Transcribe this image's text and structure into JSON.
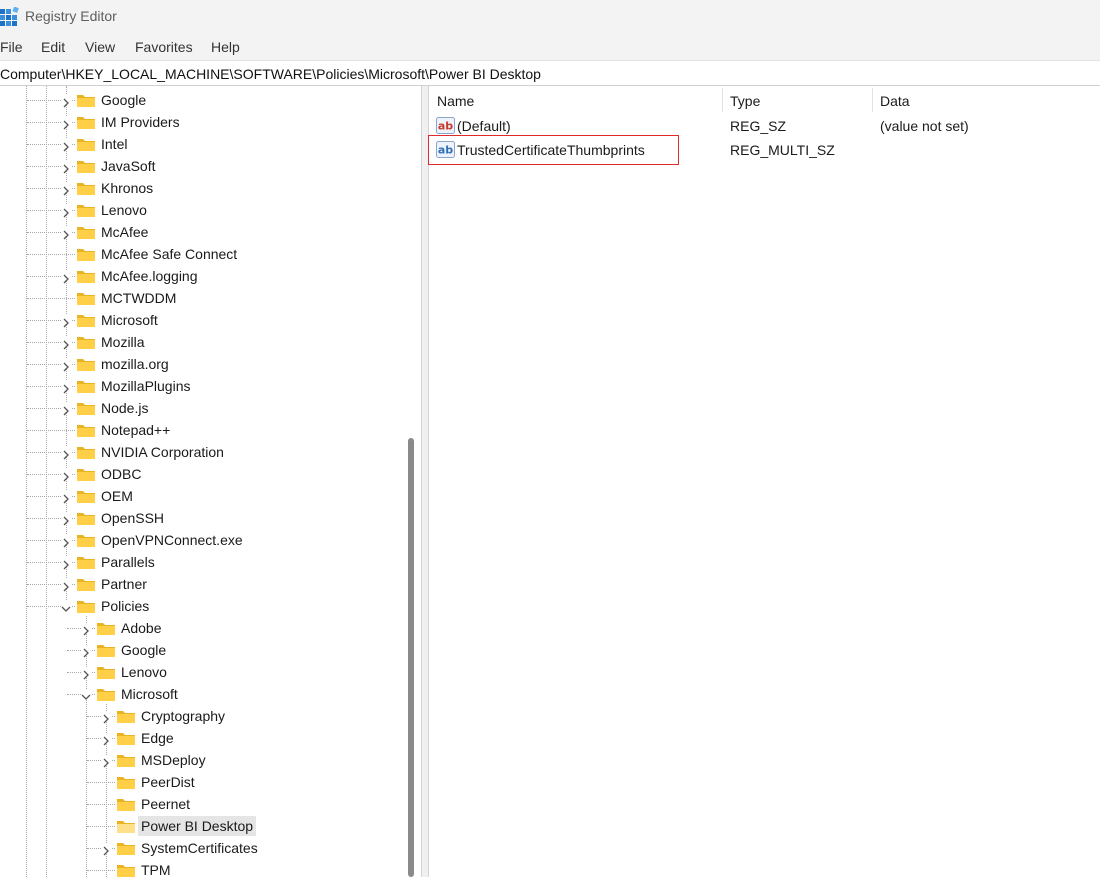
{
  "window": {
    "title": "Registry Editor",
    "app_icon": "registry-editor-icon"
  },
  "menu": {
    "file": "File",
    "edit": "Edit",
    "view": "View",
    "favorites": "Favorites",
    "help": "Help"
  },
  "address": {
    "path": "Computer\\HKEY_LOCAL_MACHINE\\SOFTWARE\\Policies\\Microsoft\\Power BI Desktop"
  },
  "tree": {
    "items": [
      {
        "label": "Google",
        "level": 0,
        "expander": "collapsed"
      },
      {
        "label": "IM Providers",
        "level": 0,
        "expander": "collapsed"
      },
      {
        "label": "Intel",
        "level": 0,
        "expander": "collapsed"
      },
      {
        "label": "JavaSoft",
        "level": 0,
        "expander": "collapsed"
      },
      {
        "label": "Khronos",
        "level": 0,
        "expander": "collapsed"
      },
      {
        "label": "Lenovo",
        "level": 0,
        "expander": "collapsed"
      },
      {
        "label": "McAfee",
        "level": 0,
        "expander": "collapsed"
      },
      {
        "label": "McAfee Safe Connect",
        "level": 0,
        "expander": "none"
      },
      {
        "label": "McAfee.logging",
        "level": 0,
        "expander": "collapsed"
      },
      {
        "label": "MCTWDDM",
        "level": 0,
        "expander": "none"
      },
      {
        "label": "Microsoft",
        "level": 0,
        "expander": "collapsed"
      },
      {
        "label": "Mozilla",
        "level": 0,
        "expander": "collapsed"
      },
      {
        "label": "mozilla.org",
        "level": 0,
        "expander": "collapsed"
      },
      {
        "label": "MozillaPlugins",
        "level": 0,
        "expander": "collapsed"
      },
      {
        "label": "Node.js",
        "level": 0,
        "expander": "collapsed"
      },
      {
        "label": "Notepad++",
        "level": 0,
        "expander": "none"
      },
      {
        "label": "NVIDIA Corporation",
        "level": 0,
        "expander": "collapsed"
      },
      {
        "label": "ODBC",
        "level": 0,
        "expander": "collapsed"
      },
      {
        "label": "OEM",
        "level": 0,
        "expander": "collapsed"
      },
      {
        "label": "OpenSSH",
        "level": 0,
        "expander": "collapsed"
      },
      {
        "label": "OpenVPNConnect.exe",
        "level": 0,
        "expander": "collapsed"
      },
      {
        "label": "Parallels",
        "level": 0,
        "expander": "collapsed"
      },
      {
        "label": "Partner",
        "level": 0,
        "expander": "collapsed"
      },
      {
        "label": "Policies",
        "level": 0,
        "expander": "expanded"
      },
      {
        "label": "Adobe",
        "level": 1,
        "expander": "collapsed"
      },
      {
        "label": "Google",
        "level": 1,
        "expander": "collapsed"
      },
      {
        "label": "Lenovo",
        "level": 1,
        "expander": "collapsed"
      },
      {
        "label": "Microsoft",
        "level": 1,
        "expander": "expanded"
      },
      {
        "label": "Cryptography",
        "level": 2,
        "expander": "collapsed"
      },
      {
        "label": "Edge",
        "level": 2,
        "expander": "collapsed"
      },
      {
        "label": "MSDeploy",
        "level": 2,
        "expander": "collapsed"
      },
      {
        "label": "PeerDist",
        "level": 2,
        "expander": "none"
      },
      {
        "label": "Peernet",
        "level": 2,
        "expander": "none"
      },
      {
        "label": "Power BI Desktop",
        "level": 2,
        "expander": "none",
        "selected": true
      },
      {
        "label": "SystemCertificates",
        "level": 2,
        "expander": "collapsed"
      },
      {
        "label": "TPM",
        "level": 2,
        "expander": "none"
      }
    ]
  },
  "values": {
    "columns": {
      "name": "Name",
      "type": "Type",
      "data": "Data"
    },
    "rows": [
      {
        "name": "(Default)",
        "type": "REG_SZ",
        "data": "(value not set)",
        "icon": "reg-sz-icon",
        "icon_color": "#c8382a"
      },
      {
        "name": "TrustedCertificateThumbprints",
        "type": "REG_MULTI_SZ",
        "data": "",
        "icon": "reg-multi-sz-icon",
        "icon_color": "#2f6fb5",
        "highlighted": true
      }
    ]
  },
  "colors": {
    "folder": "#ffcf48",
    "folder_dark": "#e9b321",
    "highlight_border": "#e02a2a",
    "selected_bg": "#e5e5e5"
  }
}
